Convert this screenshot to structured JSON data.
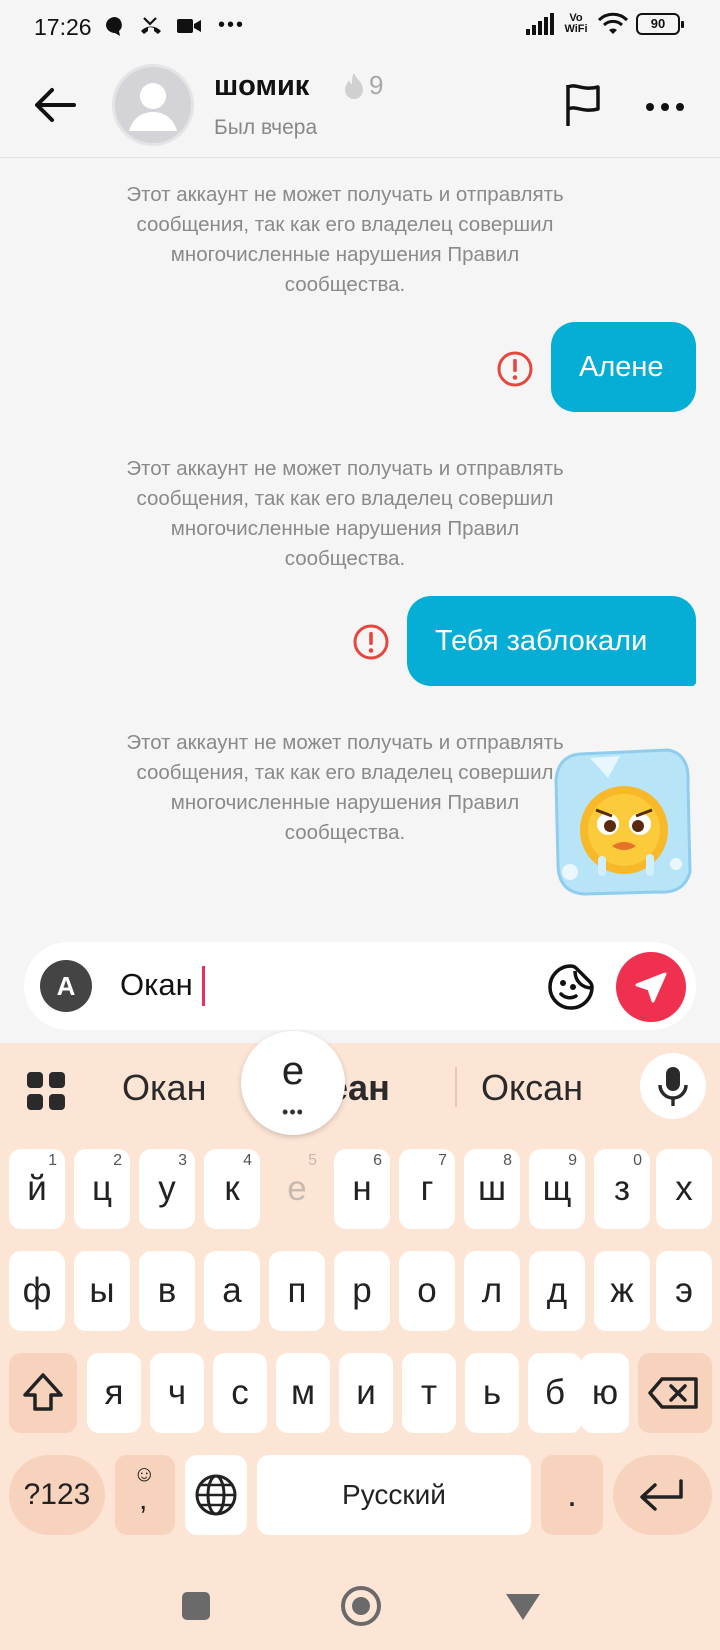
{
  "status_bar": {
    "time": "17:26",
    "left_icons": [
      "chat-icon",
      "missed-call-icon",
      "video-icon",
      "more-dots-icon"
    ],
    "network": "Vo WiFi",
    "battery": "90"
  },
  "header": {
    "name": "шомик",
    "streak_count": "9",
    "status": "Был вчера"
  },
  "chat": {
    "messages": [
      {
        "type": "system",
        "text": "Этот аккаунт не может получать и отправлять сообщения, так как его владелец совершил многочисленные нарушения Правил сообщества."
      },
      {
        "type": "outgoing",
        "text": "Алене",
        "failed": true
      },
      {
        "type": "system",
        "text": "Этот аккаунт не может получать и отправлять сообщения, так как его владелец совершил многочисленные нарушения Правил сообщества."
      },
      {
        "type": "outgoing",
        "text": "Тебя заблокали",
        "failed": true
      },
      {
        "type": "system",
        "text": "Этот аккаунт не может получать и отправлять сообщения, так как его владелец совершил многочисленные нарушения Правил сообщества."
      },
      {
        "type": "sticker",
        "sticker": "frozen-chick-sticker"
      }
    ]
  },
  "composer": {
    "keyboard_switch_label": "A",
    "input_value": "Окан"
  },
  "keyboard": {
    "suggestions": [
      "Окан",
      "Океан",
      "Оксан"
    ],
    "key_popup": "е",
    "key_popup_more": "•••",
    "rows": [
      [
        {
          "k": "й",
          "h": "1"
        },
        {
          "k": "ц",
          "h": "2"
        },
        {
          "k": "у",
          "h": "3"
        },
        {
          "k": "к",
          "h": "4"
        },
        {
          "k": "е",
          "h": "5"
        },
        {
          "k": "н",
          "h": "6"
        },
        {
          "k": "г",
          "h": "7"
        },
        {
          "k": "ш",
          "h": "8"
        },
        {
          "k": "щ",
          "h": "9"
        },
        {
          "k": "з",
          "h": "0"
        },
        {
          "k": "х",
          "h": ""
        }
      ],
      [
        {
          "k": "ф"
        },
        {
          "k": "ы"
        },
        {
          "k": "в"
        },
        {
          "k": "а"
        },
        {
          "k": "п"
        },
        {
          "k": "р"
        },
        {
          "k": "о"
        },
        {
          "k": "л"
        },
        {
          "k": "д"
        },
        {
          "k": "ж"
        },
        {
          "k": "э"
        }
      ],
      [
        {
          "k": "я"
        },
        {
          "k": "ч"
        },
        {
          "k": "с"
        },
        {
          "k": "м"
        },
        {
          "k": "и"
        },
        {
          "k": "т"
        },
        {
          "k": "ь"
        },
        {
          "k": "б"
        },
        {
          "k": "ю"
        }
      ]
    ],
    "symbols_label": "?123",
    "emoji_comma_label": ",",
    "space_label": "Русский",
    "period_label": "."
  }
}
